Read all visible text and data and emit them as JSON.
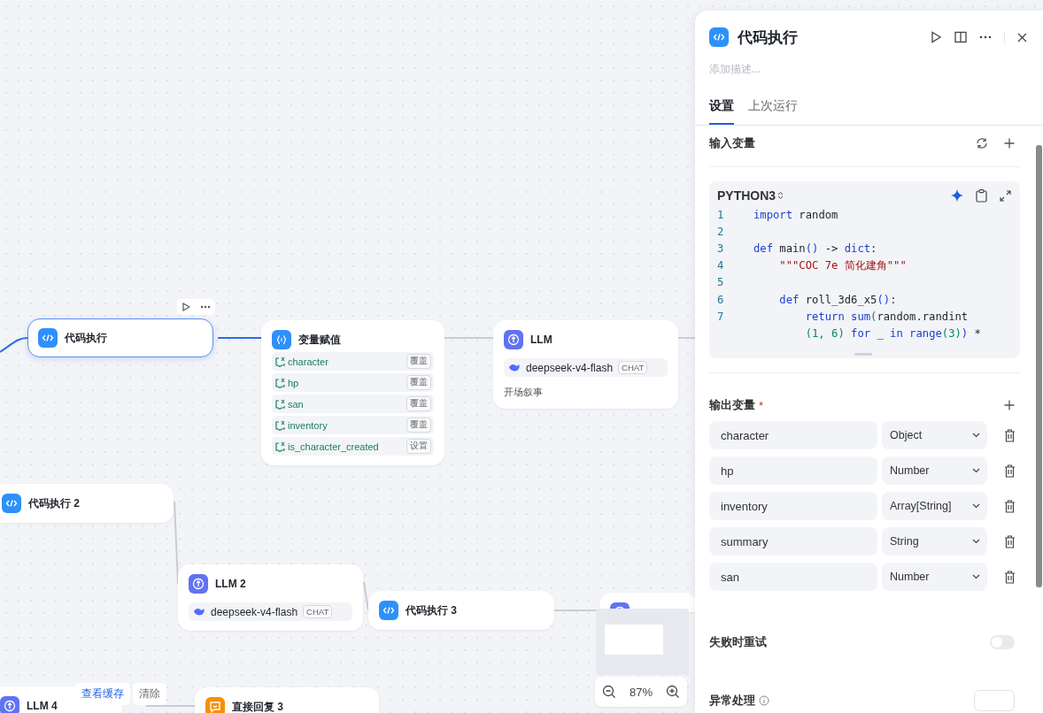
{
  "canvas": {
    "nodes": [
      {
        "kind": "code",
        "title": "代码执行",
        "selected": true
      },
      {
        "kind": "assign",
        "title": "变量赋值",
        "selected": false,
        "items": [
          {
            "name": "character",
            "action": "覆盖"
          },
          {
            "name": "hp",
            "action": "覆盖"
          },
          {
            "name": "san",
            "action": "覆盖"
          },
          {
            "name": "inventory",
            "action": "覆盖"
          },
          {
            "name": "is_character_created",
            "action": "设置"
          }
        ]
      },
      {
        "kind": "llm",
        "title": "LLM",
        "selected": false,
        "model": "deepseek-v4-flash",
        "model_tag": "CHAT",
        "note": "开场叙事"
      },
      {
        "kind": "code",
        "title": "代码执行 2",
        "selected": false
      },
      {
        "kind": "llm",
        "title": "LLM 2",
        "selected": false,
        "model": "deepseek-v4-flash",
        "model_tag": "CHAT"
      },
      {
        "kind": "code",
        "title": "代码执行 3",
        "selected": false
      },
      {
        "kind": "llm",
        "selected": false
      },
      {
        "kind": "llm",
        "title": "LLM 4",
        "selected": false
      },
      {
        "kind": "reply",
        "title": "直接回复 3",
        "selected": false
      }
    ],
    "cache_buttons": [
      "查看缓存",
      "清除"
    ],
    "zoom": {
      "reading": "87%"
    }
  },
  "panel": {
    "title": "代码执行",
    "description_placeholder": "添加描述...",
    "tabs": [
      {
        "label": "设置",
        "selected": true
      },
      {
        "label": "上次运行",
        "selected": false
      }
    ],
    "input_section": {
      "title": "输入变量"
    },
    "editor": {
      "language": "PYTHON3",
      "rows": [
        {
          "number": "1",
          "tokens": [
            {
              "text": "import",
              "kind": "kw"
            },
            {
              "text": " random",
              "kind": "plain"
            }
          ]
        },
        {
          "number": "2",
          "tokens": []
        },
        {
          "number": "3",
          "tokens": [
            {
              "text": "def",
              "kind": "kw"
            },
            {
              "text": " main",
              "kind": "plain"
            },
            {
              "text": "()",
              "kind": "kw"
            },
            {
              "text": " -> ",
              "kind": "plain"
            },
            {
              "text": "dict",
              "kind": "kw"
            },
            {
              "text": ":",
              "kind": "plain"
            }
          ]
        },
        {
          "number": "4",
          "tokens": [
            {
              "text": "    \"\"\"COC 7e 简化建角\"\"\"",
              "kind": "str"
            }
          ]
        },
        {
          "number": "5",
          "tokens": []
        },
        {
          "number": "6",
          "tokens": [
            {
              "text": "    def",
              "kind": "kw"
            },
            {
              "text": " roll_3d6_x5",
              "kind": "plain"
            },
            {
              "text": "()",
              "kind": "kw"
            },
            {
              "text": ":",
              "kind": "plain"
            }
          ]
        },
        {
          "number": "7",
          "tokens": [
            {
              "text": "        return sum",
              "kind": "kw"
            },
            {
              "text": "(",
              "kind": "num"
            },
            {
              "text": "random.randint",
              "kind": "plain"
            }
          ]
        },
        {
          "tokens": [
            {
              "text": "        (1, 6)",
              "kind": "num"
            },
            {
              "text": " for",
              "kind": "kw"
            },
            {
              "text": " _ ",
              "kind": "plain"
            },
            {
              "text": "in range",
              "kind": "kw"
            },
            {
              "text": "(3)",
              "kind": "num"
            },
            {
              "text": ")",
              "kind": "kw"
            },
            {
              "text": " *",
              "kind": "plain"
            }
          ]
        }
      ]
    },
    "output_section": {
      "title": "输出变量",
      "required": true,
      "rows": [
        {
          "name": "character",
          "type": "Object"
        },
        {
          "name": "hp",
          "type": "Number"
        },
        {
          "name": "inventory",
          "type": "Array[String]"
        },
        {
          "name": "summary",
          "type": "String"
        },
        {
          "name": "san",
          "type": "Number"
        }
      ]
    },
    "retry": {
      "label": "失败时重试",
      "on": false
    },
    "error_handling": {
      "label": "异常处理"
    }
  }
}
